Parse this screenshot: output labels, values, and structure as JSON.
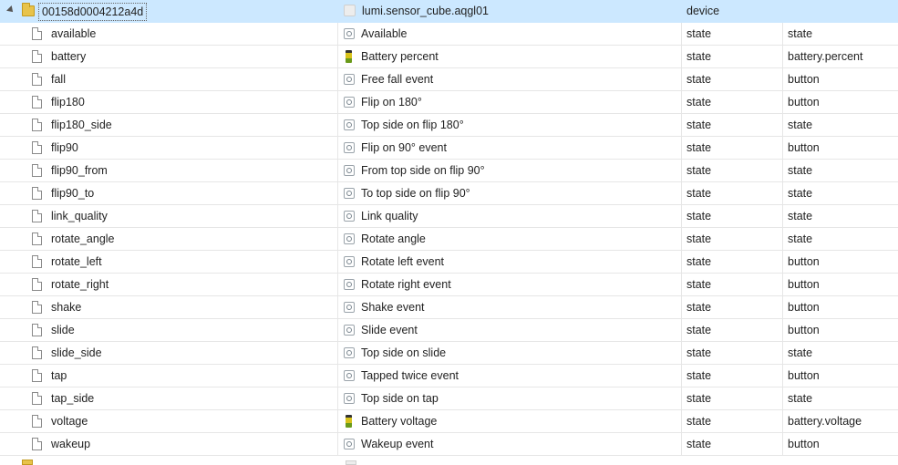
{
  "device": {
    "id": "00158d0004212a4d",
    "name": "lumi.sensor_cube.aqgl01",
    "role": "device",
    "type": ""
  },
  "states": [
    {
      "id": "available",
      "name": "Available",
      "role": "state",
      "type": "state",
      "icon": "state-icon"
    },
    {
      "id": "battery",
      "name": "Battery percent",
      "role": "state",
      "type": "battery.percent",
      "icon": "battery-icon"
    },
    {
      "id": "fall",
      "name": "Free fall event",
      "role": "state",
      "type": "button",
      "icon": "state-icon"
    },
    {
      "id": "flip180",
      "name": "Flip on 180°",
      "role": "state",
      "type": "button",
      "icon": "state-icon"
    },
    {
      "id": "flip180_side",
      "name": "Top side on flip 180°",
      "role": "state",
      "type": "state",
      "icon": "state-icon"
    },
    {
      "id": "flip90",
      "name": "Flip on 90° event",
      "role": "state",
      "type": "button",
      "icon": "state-icon"
    },
    {
      "id": "flip90_from",
      "name": "From top side on flip 90°",
      "role": "state",
      "type": "state",
      "icon": "state-icon"
    },
    {
      "id": "flip90_to",
      "name": "To top side on flip 90°",
      "role": "state",
      "type": "state",
      "icon": "state-icon"
    },
    {
      "id": "link_quality",
      "name": "Link quality",
      "role": "state",
      "type": "state",
      "icon": "state-icon"
    },
    {
      "id": "rotate_angle",
      "name": "Rotate angle",
      "role": "state",
      "type": "state",
      "icon": "state-icon"
    },
    {
      "id": "rotate_left",
      "name": "Rotate left event",
      "role": "state",
      "type": "button",
      "icon": "state-icon"
    },
    {
      "id": "rotate_right",
      "name": "Rotate right event",
      "role": "state",
      "type": "button",
      "icon": "state-icon"
    },
    {
      "id": "shake",
      "name": "Shake event",
      "role": "state",
      "type": "button",
      "icon": "state-icon"
    },
    {
      "id": "slide",
      "name": "Slide event",
      "role": "state",
      "type": "button",
      "icon": "state-icon"
    },
    {
      "id": "slide_side",
      "name": "Top side on slide",
      "role": "state",
      "type": "state",
      "icon": "state-icon"
    },
    {
      "id": "tap",
      "name": "Tapped twice event",
      "role": "state",
      "type": "button",
      "icon": "state-icon"
    },
    {
      "id": "tap_side",
      "name": "Top side on tap",
      "role": "state",
      "type": "state",
      "icon": "state-icon"
    },
    {
      "id": "voltage",
      "name": "Battery voltage",
      "role": "state",
      "type": "battery.voltage",
      "icon": "battery-icon"
    },
    {
      "id": "wakeup",
      "name": "Wakeup event",
      "role": "state",
      "type": "button",
      "icon": "state-icon"
    }
  ],
  "colors": {
    "selection": "#cce8ff",
    "grid_line": "#e6e6e6",
    "folder": "#e8c34a"
  }
}
